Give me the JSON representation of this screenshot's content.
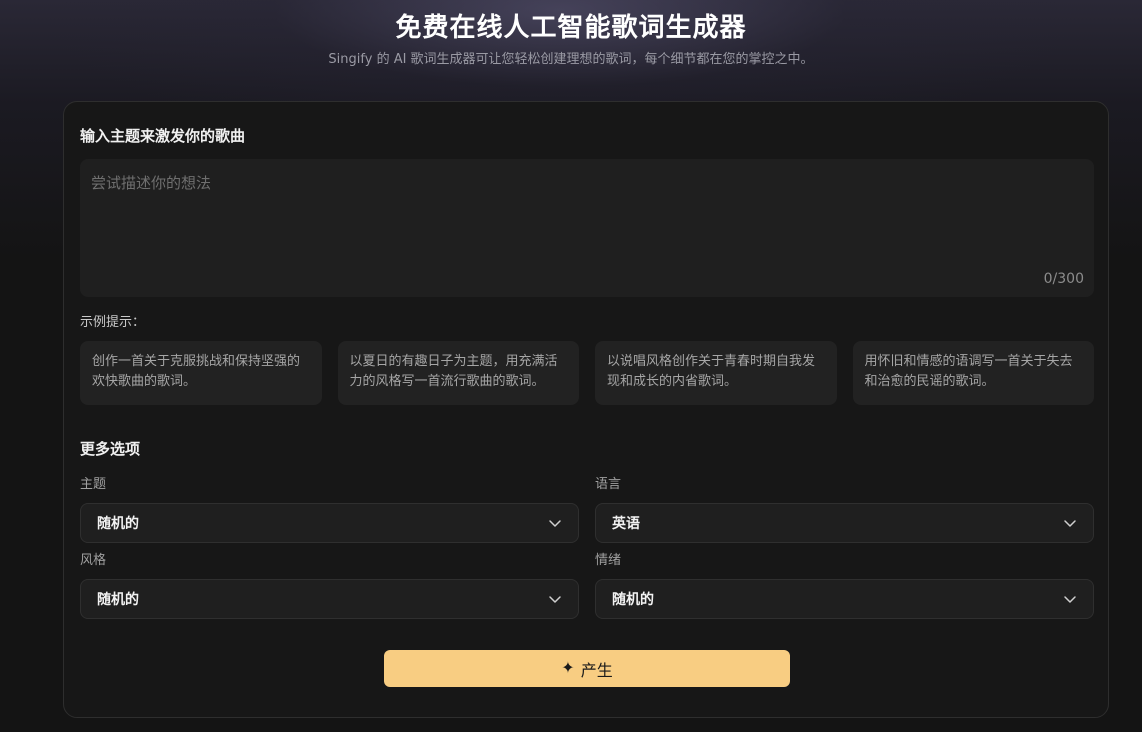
{
  "hero": {
    "title": "免费在线人工智能歌词生成器",
    "subtitle": "Singify 的 AI 歌词生成器可让您轻松创建理想的歌词，每个细节都在您的掌控之中。"
  },
  "form": {
    "topic_label": "输入主题来激发你的歌曲",
    "topic_placeholder": "尝试描述你的想法",
    "topic_value": "",
    "counter": "0/300",
    "examples_label": "示例提示：",
    "examples": [
      "创作一首关于克服挑战和保持坚强的欢快歌曲的歌词。",
      "以夏日的有趣日子为主题，用充满活力的风格写一首流行歌曲的歌词。",
      "以说唱风格创作关于青春时期自我发现和成长的内省歌词。",
      "用怀旧和情感的语调写一首关于失去和治愈的民谣的歌词。"
    ],
    "more_label": "更多选项",
    "options": {
      "theme": {
        "label": "主题",
        "value": "随机的"
      },
      "language": {
        "label": "语言",
        "value": "英语"
      },
      "style": {
        "label": "风格",
        "value": "随机的"
      },
      "mood": {
        "label": "情绪",
        "value": "随机的"
      }
    },
    "generate_label": "产生",
    "generate_icon": "sparkle-icon"
  },
  "colors": {
    "accent": "#f8cd82",
    "background": "#141414",
    "card": "#171717"
  }
}
